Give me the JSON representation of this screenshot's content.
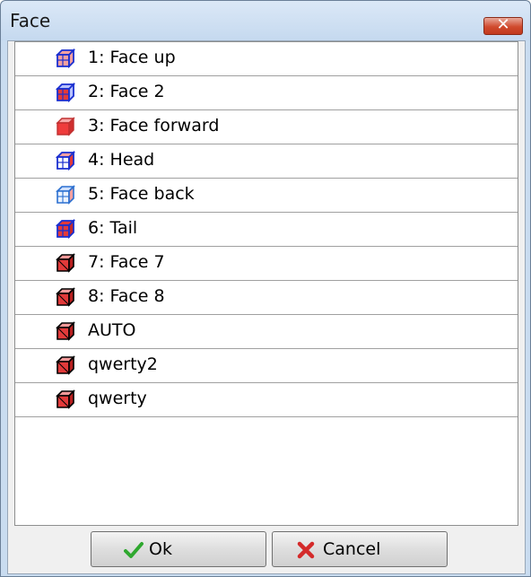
{
  "window": {
    "title": "Face",
    "close_label": "✕"
  },
  "list": {
    "items": [
      {
        "label": "1: Face up",
        "icon": "cube-face-up-icon"
      },
      {
        "label": "2: Face 2",
        "icon": "cube-face-2-icon"
      },
      {
        "label": "3: Face forward",
        "icon": "cube-face-forward-icon"
      },
      {
        "label": "4: Head",
        "icon": "cube-head-icon"
      },
      {
        "label": "5: Face back",
        "icon": "cube-face-back-icon"
      },
      {
        "label": "6: Tail",
        "icon": "cube-tail-icon"
      },
      {
        "label": "7: Face 7",
        "icon": "cube-red-icon"
      },
      {
        "label": "8: Face 8",
        "icon": "cube-red-icon"
      },
      {
        "label": "AUTO",
        "icon": "cube-red-icon"
      },
      {
        "label": "qwerty2",
        "icon": "cube-red-icon"
      },
      {
        "label": "qwerty",
        "icon": "cube-red-icon"
      }
    ]
  },
  "buttons": {
    "ok_label": "Ok",
    "cancel_label": "Cancel"
  },
  "colors": {
    "cube_blue": "#1a2fd0",
    "cube_red": "#e23a3a",
    "check_green": "#2fa82f",
    "cancel_red": "#d42a2a"
  }
}
